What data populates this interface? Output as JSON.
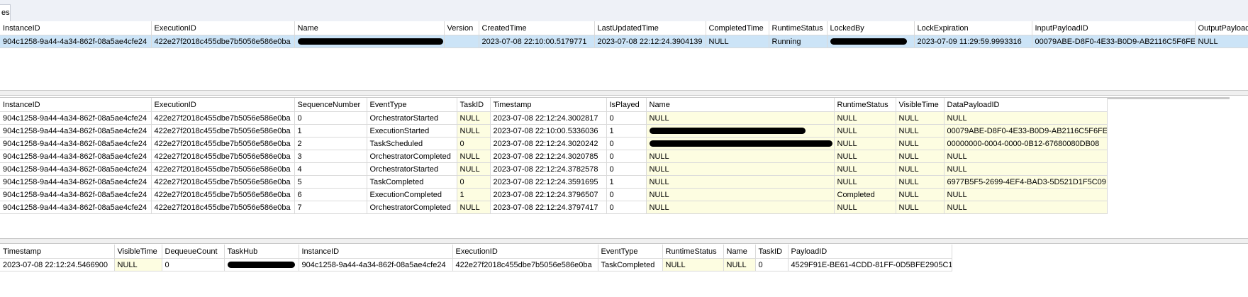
{
  "tab": {
    "label": "es"
  },
  "instances": {
    "columns": [
      "InstanceID",
      "ExecutionID",
      "Name",
      "Version",
      "CreatedTime",
      "LastUpdatedTime",
      "CompletedTime",
      "RuntimeStatus",
      "LockedBy",
      "LockExpiration",
      "InputPayloadID",
      "OutputPayloadID"
    ],
    "rows": [
      [
        "904c1258-9a44-4a34-862f-08a5ae4cfe24",
        "422e27f2018c455dbe7b5056e586e0ba",
        "[redacted]",
        "",
        "2023-07-08 22:10:00.5179771",
        "2023-07-08 22:12:24.3904139",
        "NULL",
        "Running",
        "[redacted]",
        "2023-07-09 11:29:59.9993316",
        "00079ABE-D8F0-4E33-B0D9-AB2116C5F6FE",
        "NULL"
      ]
    ]
  },
  "history": {
    "columns": [
      "InstanceID",
      "ExecutionID",
      "SequenceNumber",
      "EventType",
      "TaskID",
      "Timestamp",
      "IsPlayed",
      "Name",
      "RuntimeStatus",
      "VisibleTime",
      "DataPayloadID"
    ],
    "rows": [
      [
        "904c1258-9a44-4a34-862f-08a5ae4cfe24",
        "422e27f2018c455dbe7b5056e586e0ba",
        "0",
        "OrchestratorStarted",
        "NULL",
        "2023-07-08 22:12:24.3002817",
        "0",
        "NULL",
        "NULL",
        "NULL",
        "NULL"
      ],
      [
        "904c1258-9a44-4a34-862f-08a5ae4cfe24",
        "422e27f2018c455dbe7b5056e586e0ba",
        "1",
        "ExecutionStarted",
        "NULL",
        "2023-07-08 22:10:00.5336036",
        "1",
        "[redacted]",
        "NULL",
        "NULL",
        "00079ABE-D8F0-4E33-B0D9-AB2116C5F6FE"
      ],
      [
        "904c1258-9a44-4a34-862f-08a5ae4cfe24",
        "422e27f2018c455dbe7b5056e586e0ba",
        "2",
        "TaskScheduled",
        "0",
        "2023-07-08 22:12:24.3020242",
        "0",
        "[redacted]",
        "NULL",
        "NULL",
        "00000000-0004-0000-0B12-67680080DB08"
      ],
      [
        "904c1258-9a44-4a34-862f-08a5ae4cfe24",
        "422e27f2018c455dbe7b5056e586e0ba",
        "3",
        "OrchestratorCompleted",
        "NULL",
        "2023-07-08 22:12:24.3020785",
        "0",
        "NULL",
        "NULL",
        "NULL",
        "NULL"
      ],
      [
        "904c1258-9a44-4a34-862f-08a5ae4cfe24",
        "422e27f2018c455dbe7b5056e586e0ba",
        "4",
        "OrchestratorStarted",
        "NULL",
        "2023-07-08 22:12:24.3782578",
        "0",
        "NULL",
        "NULL",
        "NULL",
        "NULL"
      ],
      [
        "904c1258-9a44-4a34-862f-08a5ae4cfe24",
        "422e27f2018c455dbe7b5056e586e0ba",
        "5",
        "TaskCompleted",
        "0",
        "2023-07-08 22:12:24.3591695",
        "1",
        "NULL",
        "NULL",
        "NULL",
        "6977B5F5-2699-4EF4-BAD3-5D521D1F5C09"
      ],
      [
        "904c1258-9a44-4a34-862f-08a5ae4cfe24",
        "422e27f2018c455dbe7b5056e586e0ba",
        "6",
        "ExecutionCompleted",
        "1",
        "2023-07-08 22:12:24.3796507",
        "0",
        "NULL",
        "Completed",
        "NULL",
        "NULL"
      ],
      [
        "904c1258-9a44-4a34-862f-08a5ae4cfe24",
        "422e27f2018c455dbe7b5056e586e0ba",
        "7",
        "OrchestratorCompleted",
        "NULL",
        "2023-07-08 22:12:24.3797417",
        "0",
        "NULL",
        "NULL",
        "NULL",
        "NULL"
      ]
    ]
  },
  "queue": {
    "columns": [
      "Timestamp",
      "VisibleTime",
      "DequeueCount",
      "TaskHub",
      "InstanceID",
      "ExecutionID",
      "EventType",
      "RuntimeStatus",
      "Name",
      "TaskID",
      "PayloadID"
    ],
    "rows": [
      [
        "2023-07-08 22:12:24.5466900",
        "NULL",
        "0",
        "[redacted]",
        "904c1258-9a44-4a34-862f-08a5ae4cfe24",
        "422e27f2018c455dbe7b5056e586e0ba",
        "TaskCompleted",
        "NULL",
        "NULL",
        "0",
        "4529F91E-BE61-4CDD-81FF-0D5BFE2905C1"
      ]
    ]
  }
}
